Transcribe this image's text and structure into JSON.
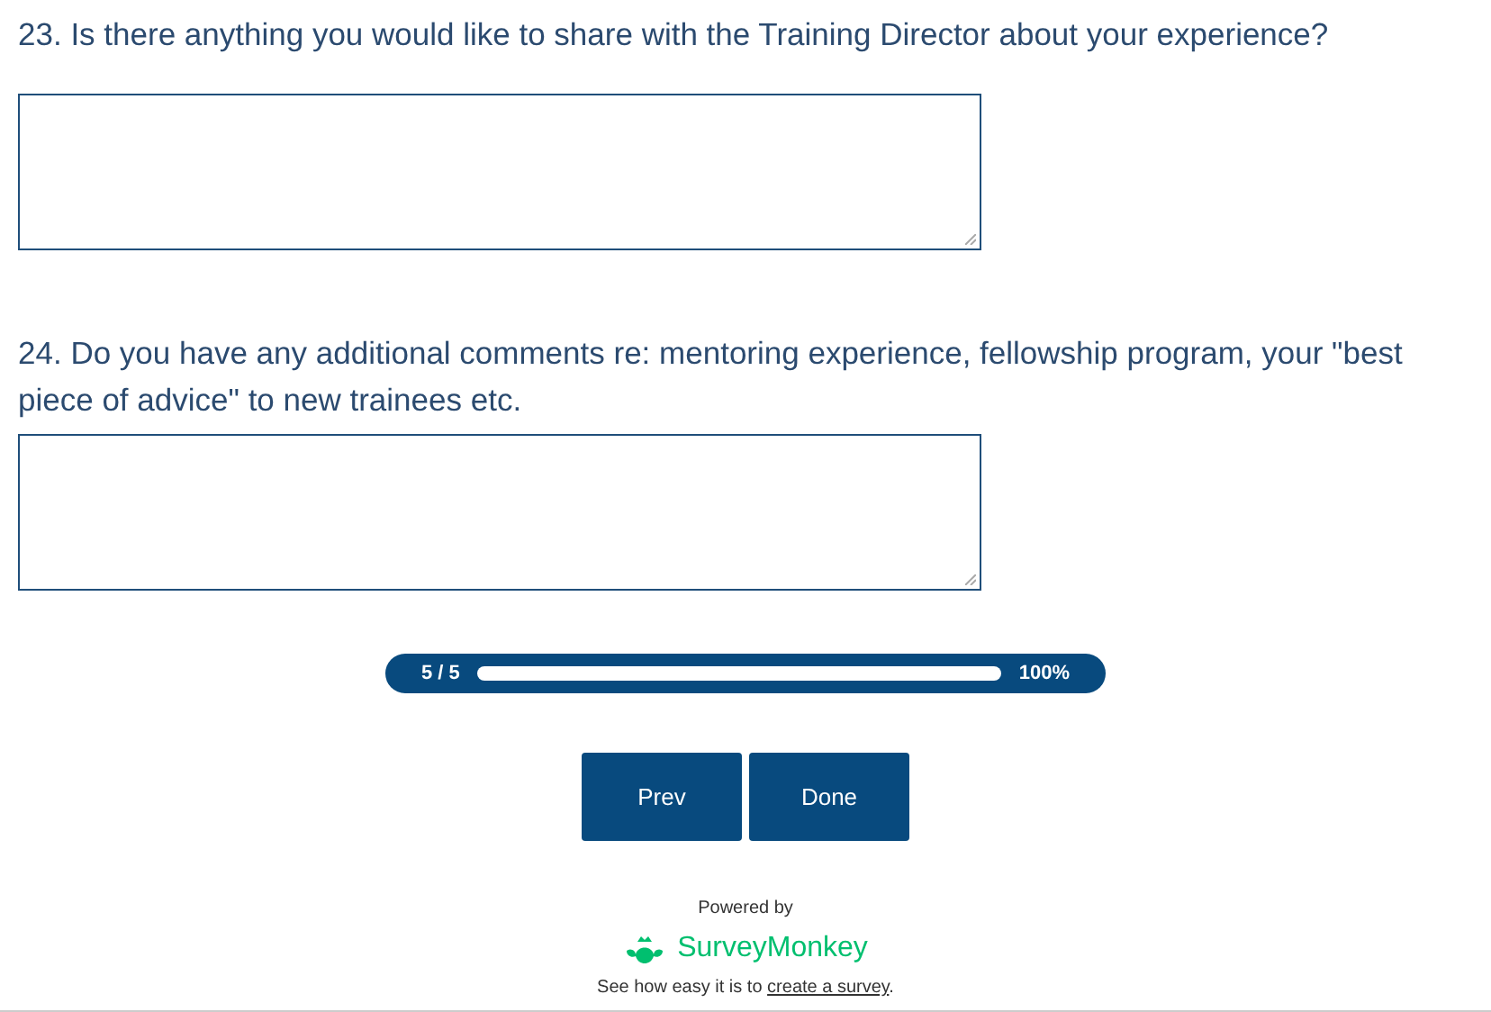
{
  "questions": [
    {
      "text": "23. Is there anything you would like to share with the Training Director about your experience?"
    },
    {
      "text": "24. Do you have any additional comments re: mentoring experience, fellowship program, your \"best piece of advice\" to new trainees etc."
    }
  ],
  "progress": {
    "page": "5 / 5",
    "level": 1,
    "percent": "100%"
  },
  "buttons": [
    "Prev",
    "Done"
  ],
  "footer": {
    "powered_by": "Powered by",
    "brand": "SurveyMonkey",
    "text_before": "See how easy it is to ",
    "link": "create a survey",
    "text_after": "."
  }
}
